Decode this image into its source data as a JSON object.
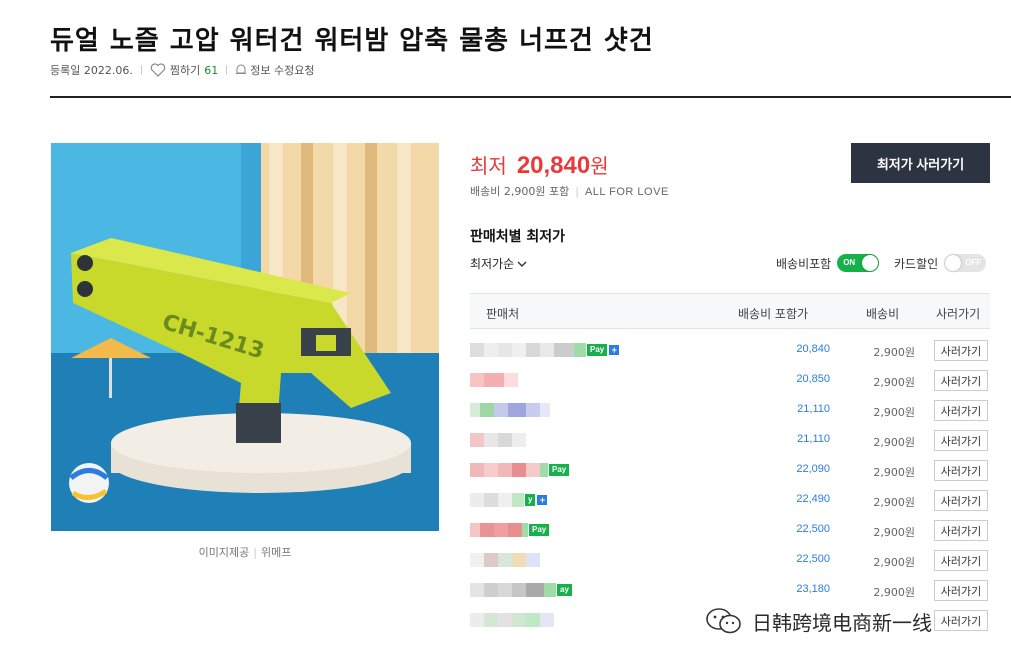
{
  "product": {
    "title": "듀얼 노즐 고압 워터건 워터밤 압축 물총 너프건 샷건",
    "registered": "등록일 2022.06.",
    "zzim_label": "찜하기",
    "zzim_count": "61",
    "edit_request": "정보 수정요청",
    "image_credit_label": "이미지제공",
    "image_credit_source": "위메프",
    "image_text": "CH-1213"
  },
  "price": {
    "label": "최저",
    "value": "20,840",
    "unit": "원",
    "shipping": "배송비 2,900원 포함",
    "mall": "ALL FOR LOVE",
    "buy_button": "최저가 사러가기"
  },
  "sellers": {
    "section_title": "판매처별 최저가",
    "sort_label": "최저가순",
    "ship_incl_label": "배송비포함",
    "ship_incl_state": "ON",
    "card_label": "카드할인",
    "card_state": "OFF",
    "headers": {
      "seller": "판매처",
      "price_with_ship": "배송비 포함가",
      "ship": "배송비",
      "buy": "사러가기"
    },
    "rows": [
      {
        "price": "20,840",
        "ship": "2,900원",
        "buy": "사러가기",
        "pay": "Pay",
        "plus": "+"
      },
      {
        "price": "20,850",
        "ship": "2,900원",
        "buy": "사러가기"
      },
      {
        "price": "21,110",
        "ship": "2,900원",
        "buy": "사러가기"
      },
      {
        "price": "21,110",
        "ship": "2,900원",
        "buy": "사러가기"
      },
      {
        "price": "22,090",
        "ship": "2,900원",
        "buy": "사러가기",
        "pay": "Pay"
      },
      {
        "price": "22,490",
        "ship": "2,900원",
        "buy": "사러가기",
        "pay": "y",
        "plus": "+"
      },
      {
        "price": "22,500",
        "ship": "2,900원",
        "buy": "사러가기",
        "pay": "Pay"
      },
      {
        "price": "22,500",
        "ship": "2,900원",
        "buy": "사러가기"
      },
      {
        "price": "23,180",
        "ship": "2,900원",
        "buy": "사러가기",
        "pay": "ay"
      },
      {
        "price": "",
        "ship": "",
        "buy": "사러가기"
      }
    ]
  },
  "watermark": "日韩跨境电商新一线",
  "colors": {
    "accent_red": "#e83a3a",
    "pay_green": "#17b14b",
    "link_blue": "#2b7de1",
    "button_dark": "#2c3442"
  },
  "icons": [
    "heart-icon",
    "bell-icon",
    "chevron-down-icon",
    "wechat-icon"
  ]
}
